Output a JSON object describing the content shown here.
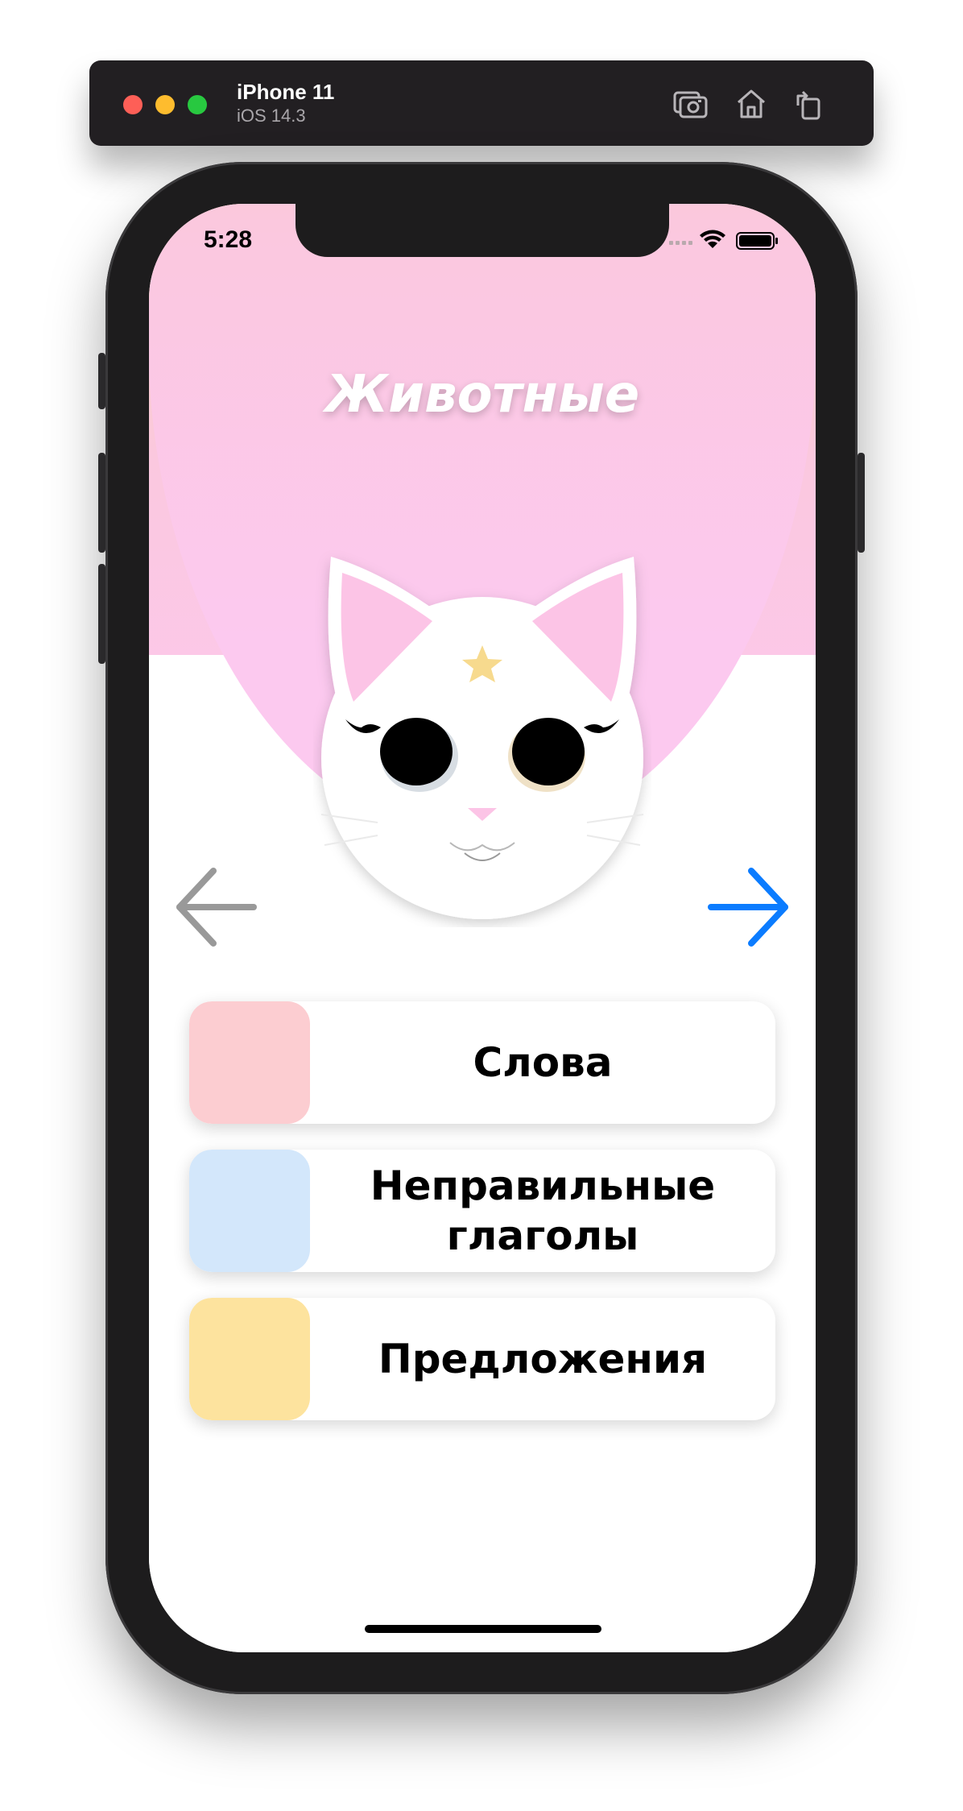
{
  "simulator": {
    "device_name": "iPhone 11",
    "os_version": "iOS 14.3",
    "toolbar_icons": [
      "screenshot-icon",
      "home-icon",
      "rotate-icon"
    ]
  },
  "status_bar": {
    "time": "5:28",
    "icons": [
      "signal-icon",
      "wifi-icon",
      "battery-icon"
    ]
  },
  "screen": {
    "title": "Животные",
    "illustration": "cat-face",
    "nav": {
      "prev_icon": "arrow-left-icon",
      "next_icon": "arrow-right-icon",
      "prev_color": "#999999",
      "next_color": "#0b7cff"
    },
    "menu": [
      {
        "label": "Слова",
        "swatch_color": "#fccdd1"
      },
      {
        "label": "Неправильные глаголы",
        "swatch_color": "#d3e7fb"
      },
      {
        "label": "Предложения",
        "swatch_color": "#fde39e"
      }
    ]
  },
  "colors": {
    "gradient_top": "#f9d0b6",
    "gradient_bottom": "#fcc9ef",
    "accent_blue": "#0b7cff"
  }
}
